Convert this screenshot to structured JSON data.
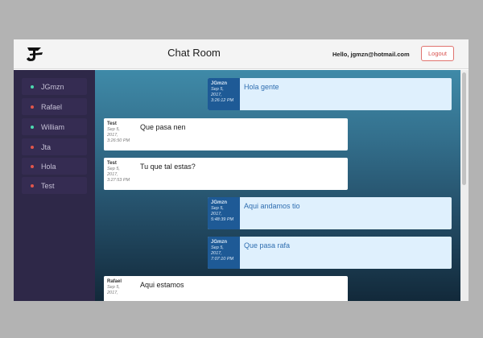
{
  "header": {
    "title": "Chat Room",
    "greeting": "Hello, jgmzn@hotmail.com",
    "logout_label": "Logout",
    "logo_icon": "app-logo-icon"
  },
  "sidebar": {
    "users": [
      {
        "name": "JGmzn",
        "status": "online",
        "color": "#4cd9b0"
      },
      {
        "name": "Rafael",
        "status": "offline",
        "color": "#e0564c"
      },
      {
        "name": "William",
        "status": "online",
        "color": "#4cd9b0"
      },
      {
        "name": "Jta",
        "status": "offline",
        "color": "#e0564c"
      },
      {
        "name": "Hola",
        "status": "offline",
        "color": "#e0564c"
      },
      {
        "name": "Test",
        "status": "offline",
        "color": "#e0564c"
      }
    ]
  },
  "messages": [
    {
      "author": "JGmzn",
      "date": [
        "Sep 5,",
        "2017,",
        "3:26:12 PM"
      ],
      "text": "Hola gente",
      "mine": true
    },
    {
      "author": "Test",
      "date": [
        "Sep 5,",
        "2017,",
        "3:26:50 PM"
      ],
      "text": "Que pasa nen",
      "mine": false
    },
    {
      "author": "Test",
      "date": [
        "Sep 5,",
        "2017,",
        "3:27:53 PM"
      ],
      "text": "Tu que tal estas?",
      "mine": false
    },
    {
      "author": "JGmzn",
      "date": [
        "Sep 5,",
        "2017,",
        "5:48:39 PM"
      ],
      "text": "Aqui andamos tio",
      "mine": true
    },
    {
      "author": "JGmzn",
      "date": [
        "Sep 5,",
        "2017,",
        "7:07:10 PM"
      ],
      "text": "Que pasa rafa",
      "mine": true
    },
    {
      "author": "Rafael",
      "date": [
        "Sep 5,",
        "2017,",
        ""
      ],
      "text": "Aqui estamos",
      "mine": false
    }
  ],
  "colors": {
    "sidebar_bg": "#2e2848",
    "own_message_bg": "#dff0fd",
    "own_meta_bg": "#1e5a96",
    "logout_red": "#d9534f"
  }
}
